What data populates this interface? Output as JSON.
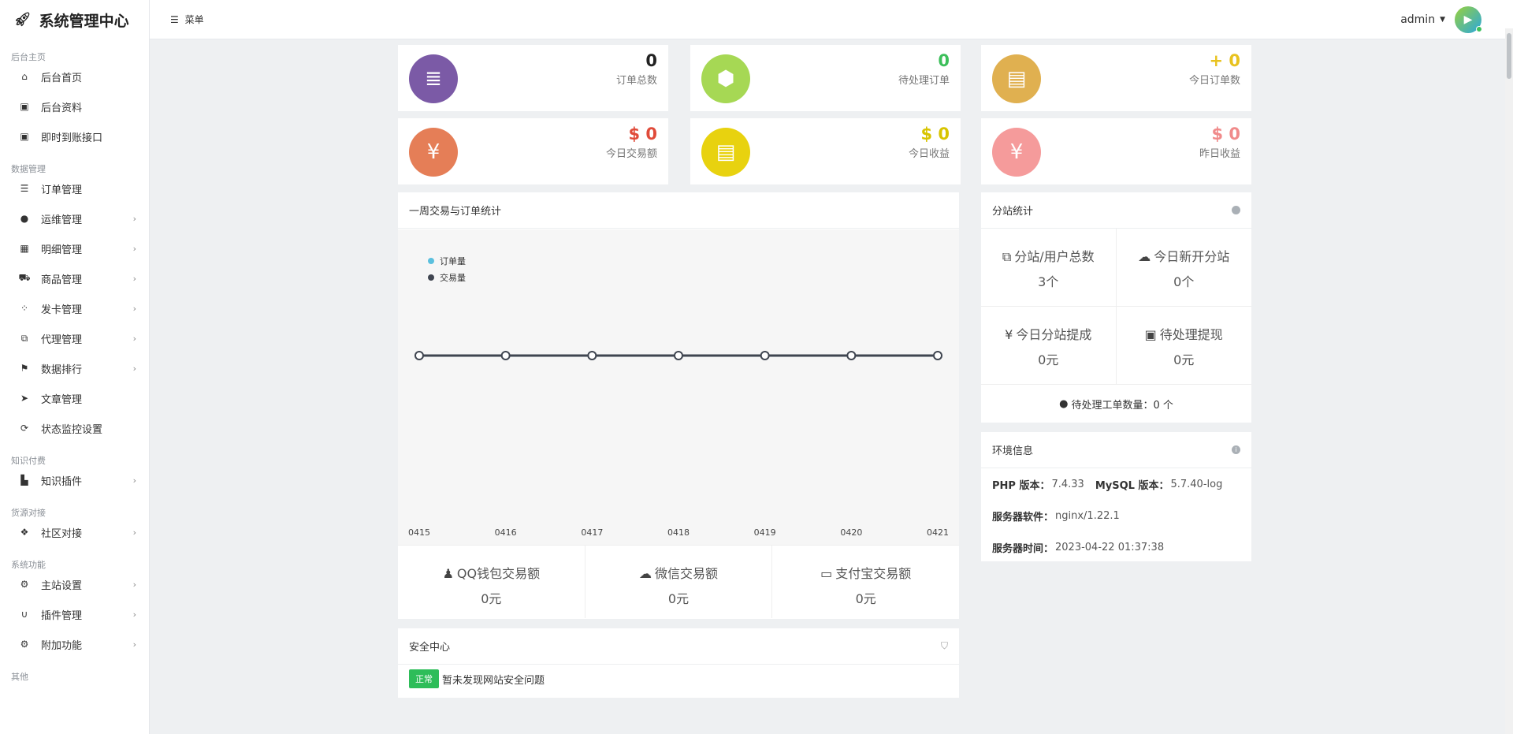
{
  "brand": {
    "title": "系统管理中心"
  },
  "topbar": {
    "menu_label": "菜单",
    "username": "admin"
  },
  "sidebar": {
    "sections": [
      {
        "title": "后台主页",
        "items": [
          {
            "label": "后台首页",
            "icon": "home-icon",
            "glyph": "⌂",
            "arrow": false
          },
          {
            "label": "后台资料",
            "icon": "id-card-icon",
            "glyph": "▣",
            "arrow": false
          },
          {
            "label": "即时到账接口",
            "icon": "id-card-icon",
            "glyph": "▣",
            "arrow": false
          }
        ]
      },
      {
        "title": "数据管理",
        "items": [
          {
            "label": "订单管理",
            "icon": "list-icon",
            "glyph": "☰",
            "arrow": false
          },
          {
            "label": "运维管理",
            "icon": "comments-icon",
            "glyph": "●",
            "arrow": true
          },
          {
            "label": "明细管理",
            "icon": "calendar-icon",
            "glyph": "▦",
            "arrow": true
          },
          {
            "label": "商品管理",
            "icon": "cart-icon",
            "glyph": "⛟",
            "arrow": true
          },
          {
            "label": "发卡管理",
            "icon": "grid-icon",
            "glyph": "⁘",
            "arrow": true
          },
          {
            "label": "代理管理",
            "icon": "sitemap-icon",
            "glyph": "⧉",
            "arrow": true
          },
          {
            "label": "数据排行",
            "icon": "flag-icon",
            "glyph": "⚑",
            "arrow": true
          },
          {
            "label": "文章管理",
            "icon": "send-icon",
            "glyph": "➤",
            "arrow": false
          },
          {
            "label": "状态监控设置",
            "icon": "refresh-icon",
            "glyph": "⟳",
            "arrow": false
          }
        ]
      },
      {
        "title": "知识付费",
        "items": [
          {
            "label": "知识插件",
            "icon": "industry-icon",
            "glyph": "▙",
            "arrow": true
          }
        ]
      },
      {
        "title": "货源对接",
        "items": [
          {
            "label": "社区对接",
            "icon": "cubes-icon",
            "glyph": "❖",
            "arrow": true
          }
        ]
      },
      {
        "title": "系统功能",
        "items": [
          {
            "label": "主站设置",
            "icon": "gear-icon",
            "glyph": "⚙",
            "arrow": true
          },
          {
            "label": "插件管理",
            "icon": "magnet-icon",
            "glyph": "∪",
            "arrow": true
          },
          {
            "label": "附加功能",
            "icon": "cogs-icon",
            "glyph": "⚙",
            "arrow": true
          }
        ]
      },
      {
        "title": "其他",
        "items": []
      }
    ]
  },
  "stats": [
    {
      "value": "0",
      "label": "订单总数",
      "color": "#7b5aa6",
      "num_color": "#222",
      "icon": "list-ol-icon",
      "glyph": "≣"
    },
    {
      "value": "0",
      "label": "待处理订单",
      "color": "#a6d854",
      "num_color": "#3cbf5a",
      "icon": "cube-icon",
      "glyph": "⬢"
    },
    {
      "value": "+ 0",
      "label": "今日订单数",
      "color": "#e0b050",
      "num_color": "#e8c21e",
      "icon": "briefcase-icon",
      "glyph": "▤"
    },
    {
      "value": "$ 0",
      "label": "今日交易额",
      "color": "#e57e57",
      "num_color": "#e04b3a",
      "icon": "yen-icon",
      "glyph": "¥"
    },
    {
      "value": "$ 0",
      "label": "今日收益",
      "color": "#e8d20f",
      "num_color": "#d8c400",
      "icon": "briefcase-icon",
      "glyph": "▤"
    },
    {
      "value": "$ 0",
      "label": "昨日收益",
      "color": "#f59b9b",
      "num_color": "#f08a8a",
      "icon": "yen-icon",
      "glyph": "¥"
    }
  ],
  "chart_panel": {
    "title": "一周交易与订单统计"
  },
  "chart_data": {
    "type": "line",
    "categories": [
      "0415",
      "0416",
      "0417",
      "0418",
      "0419",
      "0420",
      "0421"
    ],
    "series": [
      {
        "name": "订单量",
        "values": [
          0,
          0,
          0,
          0,
          0,
          0,
          0
        ],
        "color": "#5bc0de"
      },
      {
        "name": "交易量",
        "values": [
          0,
          0,
          0,
          0,
          0,
          0,
          0
        ],
        "color": "#3f4550"
      }
    ]
  },
  "payments": [
    {
      "label": "QQ钱包交易额",
      "value": "0元",
      "icon": "qq-icon",
      "glyph": "♟"
    },
    {
      "label": "微信交易额",
      "value": "0元",
      "icon": "wechat-icon",
      "glyph": "☁"
    },
    {
      "label": "支付宝交易额",
      "value": "0元",
      "icon": "credit-card-icon",
      "glyph": "▭"
    }
  ],
  "security": {
    "title": "安全中心",
    "badge": "正常",
    "message": "暂未发现网站安全问题"
  },
  "substation": {
    "title": "分站统计",
    "cells": [
      {
        "label": "分站/用户总数",
        "value": "3个",
        "icon": "sitemap-icon",
        "glyph": "⧉"
      },
      {
        "label": "今日新开分站",
        "value": "0个",
        "icon": "cloud-icon",
        "glyph": "☁"
      },
      {
        "label": "今日分站提成",
        "value": "0元",
        "icon": "yen-icon",
        "glyph": "¥"
      },
      {
        "label": "待处理提现",
        "value": "0元",
        "icon": "money-icon",
        "glyph": "▣"
      }
    ],
    "ticket": "待处理工单数量：0 个"
  },
  "env": {
    "title": "环境信息",
    "php_label": "PHP 版本：",
    "php": "7.4.33",
    "mysql_label": "MySQL 版本：",
    "mysql": "5.7.40-log",
    "server_label": "服务器软件：",
    "server": "nginx/1.22.1",
    "time_label": "服务器时间：",
    "time": "2023-04-22 01:37:38"
  }
}
